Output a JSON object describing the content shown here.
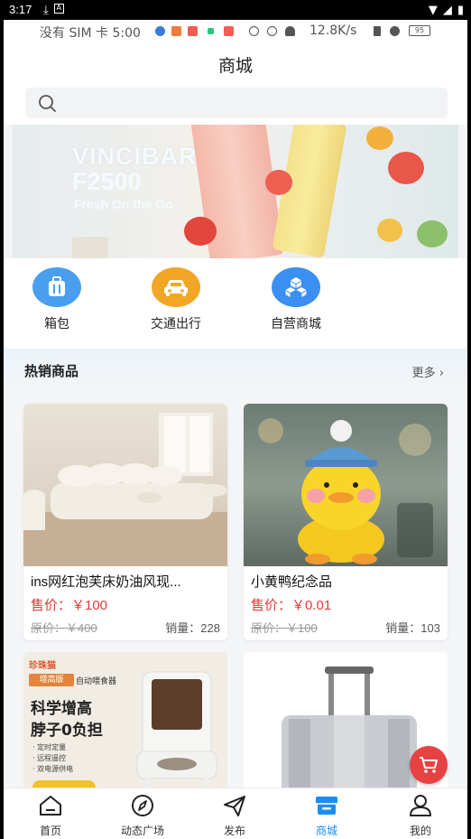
{
  "system": {
    "time": "3:17"
  },
  "inner_status": {
    "carrier": "没有 SIM 卡 5:00",
    "speed": "12.8K/s",
    "battery": "95"
  },
  "header": {
    "title": "商城"
  },
  "search": {
    "placeholder": ""
  },
  "banner": {
    "brand": "VINCIBAR",
    "model": "F2500",
    "tagline": "Fresh On the Go"
  },
  "categories": [
    {
      "label": "箱包",
      "icon": "luggage-icon",
      "color": "#4a9ef0"
    },
    {
      "label": "交通出行",
      "icon": "car-icon",
      "color": "#f2a626"
    },
    {
      "label": "自营商城",
      "icon": "cubes-icon",
      "color": "#3b8ff0"
    }
  ],
  "hot": {
    "title": "热销商品",
    "more": "更多 ›"
  },
  "products": [
    {
      "name": "ins网红泡芙床奶油风现...",
      "price": "售价：￥100",
      "orig": "原价：￥400",
      "sales": "销量：228"
    },
    {
      "name": "小黄鸭纪念品",
      "price": "售价：￥0.01",
      "orig": "原价：￥100",
      "sales": "销量：103"
    }
  ],
  "feeder_ad": {
    "brand": "珍珠猫",
    "badge": "增高版",
    "sub": "自动喂食器",
    "line1": "科学增高",
    "line2": "脖子0负担",
    "bullets": [
      "· 定时定量",
      "· 远程遥控",
      "· 双电源供电"
    ]
  },
  "tabs": [
    {
      "label": "首页",
      "icon": "home-icon",
      "active": false
    },
    {
      "label": "动态广场",
      "icon": "compass-icon",
      "active": false
    },
    {
      "label": "发布",
      "icon": "send-icon",
      "active": false
    },
    {
      "label": "商城",
      "icon": "store-icon",
      "active": true
    },
    {
      "label": "我的",
      "icon": "user-icon",
      "active": false
    }
  ]
}
